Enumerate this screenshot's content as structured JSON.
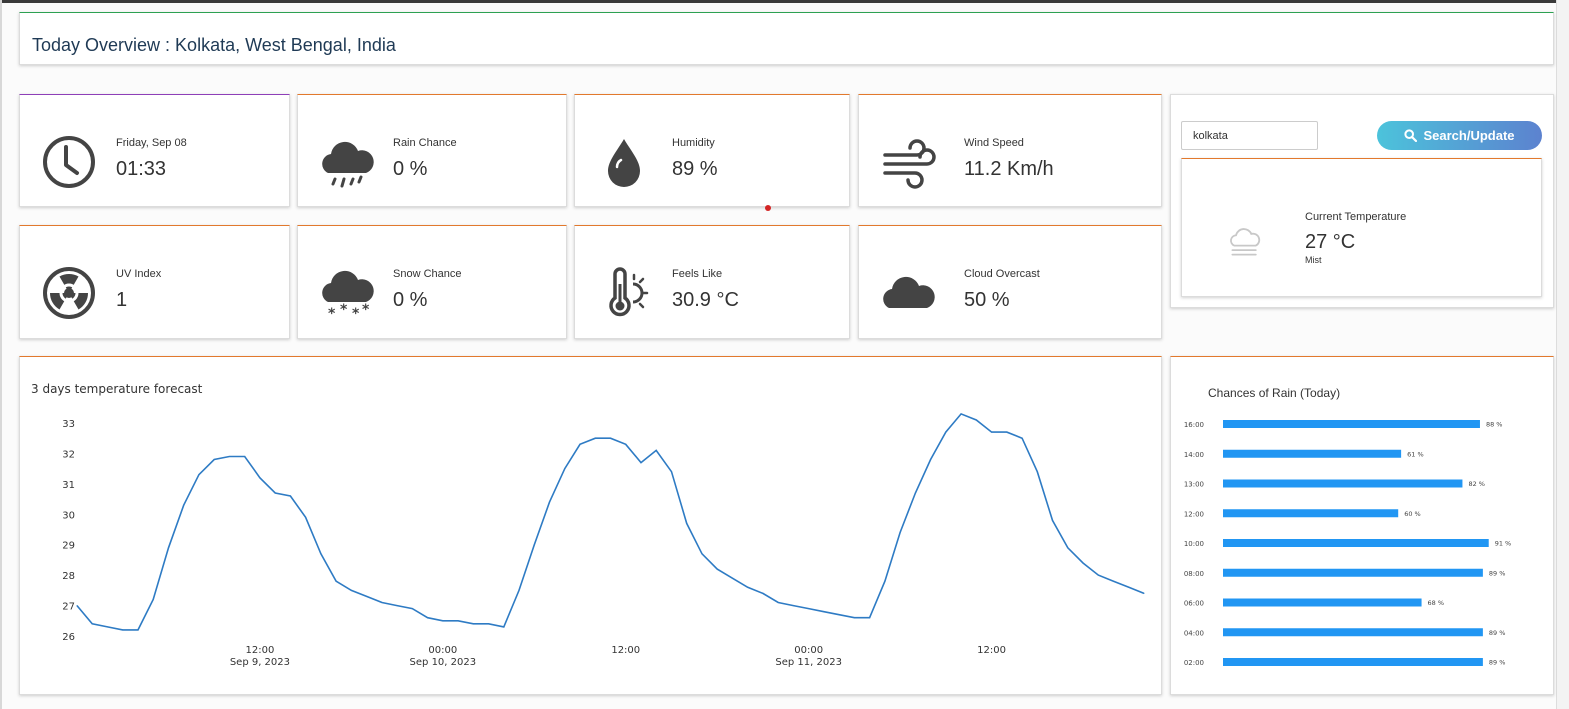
{
  "header": {
    "title": "Today Overview : Kolkata, West Bengal, India"
  },
  "stats": {
    "time": {
      "label": "Friday, Sep 08",
      "value": "01:33",
      "icon": "clock-icon"
    },
    "rain": {
      "label": "Rain Chance",
      "value": "0 %",
      "icon": "rain-cloud-icon"
    },
    "humidity": {
      "label": "Humidity",
      "value": "89 %",
      "icon": "water-drop-icon"
    },
    "wind": {
      "label": "Wind Speed",
      "value": "11.2 Km/h",
      "icon": "wind-icon"
    },
    "uv": {
      "label": "UV Index",
      "value": "1",
      "icon": "radiation-icon"
    },
    "snow": {
      "label": "Snow Chance",
      "value": "0 %",
      "icon": "snow-cloud-icon"
    },
    "feels": {
      "label": "Feels Like",
      "value": "30.9 °C",
      "icon": "thermometer-sun-icon"
    },
    "cloud": {
      "label": "Cloud Overcast",
      "value": "50 %",
      "icon": "cloud-icon"
    }
  },
  "search": {
    "value": "kolkata",
    "button_label": "Search/Update"
  },
  "current": {
    "label": "Current Temperature",
    "value": "27 °C",
    "condition": "Mist",
    "icon": "mist-cloud-icon"
  },
  "colors": {
    "accent_orange": "#e2792d",
    "line": "#2e7bc4",
    "bar": "#2196f3"
  },
  "chart_data": [
    {
      "type": "line",
      "title": "3 days temperature forecast",
      "x_ticks": [
        {
          "time": "12:00",
          "date": "Sep 9, 2023",
          "hour": 12
        },
        {
          "time": "00:00",
          "date": "Sep 10, 2023",
          "hour": 24
        },
        {
          "time": "12:00",
          "date": "",
          "hour": 36
        },
        {
          "time": "00:00",
          "date": "Sep 11, 2023",
          "hour": 48
        },
        {
          "time": "12:00",
          "date": "",
          "hour": 60
        }
      ],
      "ylim": [
        26,
        33
      ],
      "y_ticks": [
        26,
        27,
        28,
        29,
        30,
        31,
        32,
        33
      ],
      "x_start": "Sep 8, 2023 22:00",
      "x_step": "1 hour",
      "series": [
        {
          "values": [
            27.0,
            26.4,
            26.3,
            26.2,
            26.2,
            27.2,
            28.9,
            30.3,
            31.3,
            31.8,
            31.9,
            31.9,
            31.2,
            30.7,
            30.6,
            29.9,
            28.7,
            27.8,
            27.5,
            27.3,
            27.1,
            27.0,
            26.9,
            26.6,
            26.5,
            26.5,
            26.4,
            26.4,
            26.3,
            27.5,
            29.0,
            30.4,
            31.5,
            32.3,
            32.5,
            32.5,
            32.3,
            31.7,
            32.1,
            31.4,
            29.7,
            28.7,
            28.2,
            27.9,
            27.6,
            27.4,
            27.1,
            27.0,
            26.9,
            26.8,
            26.7,
            26.6,
            26.6,
            27.8,
            29.4,
            30.7,
            31.8,
            32.7,
            33.3,
            33.1,
            32.7,
            32.7,
            32.5,
            31.4,
            29.8,
            28.9,
            28.4,
            28.0,
            27.8,
            27.6,
            27.4
          ]
        }
      ]
    },
    {
      "type": "bar",
      "title": "Chances of Rain (Today)",
      "orientation": "horizontal",
      "categories": [
        "16:00",
        "14:00",
        "13:00",
        "12:00",
        "10:00",
        "08:00",
        "06:00",
        "04:00",
        "02:00"
      ],
      "values": [
        88,
        61,
        82,
        60,
        91,
        89,
        68,
        89,
        89
      ],
      "value_labels": [
        "88 %",
        "61 %",
        "82 %",
        "60 %",
        "91 %",
        "89 %",
        "68 %",
        "89 %",
        "89 %"
      ],
      "xlim": [
        0,
        100
      ]
    }
  ]
}
